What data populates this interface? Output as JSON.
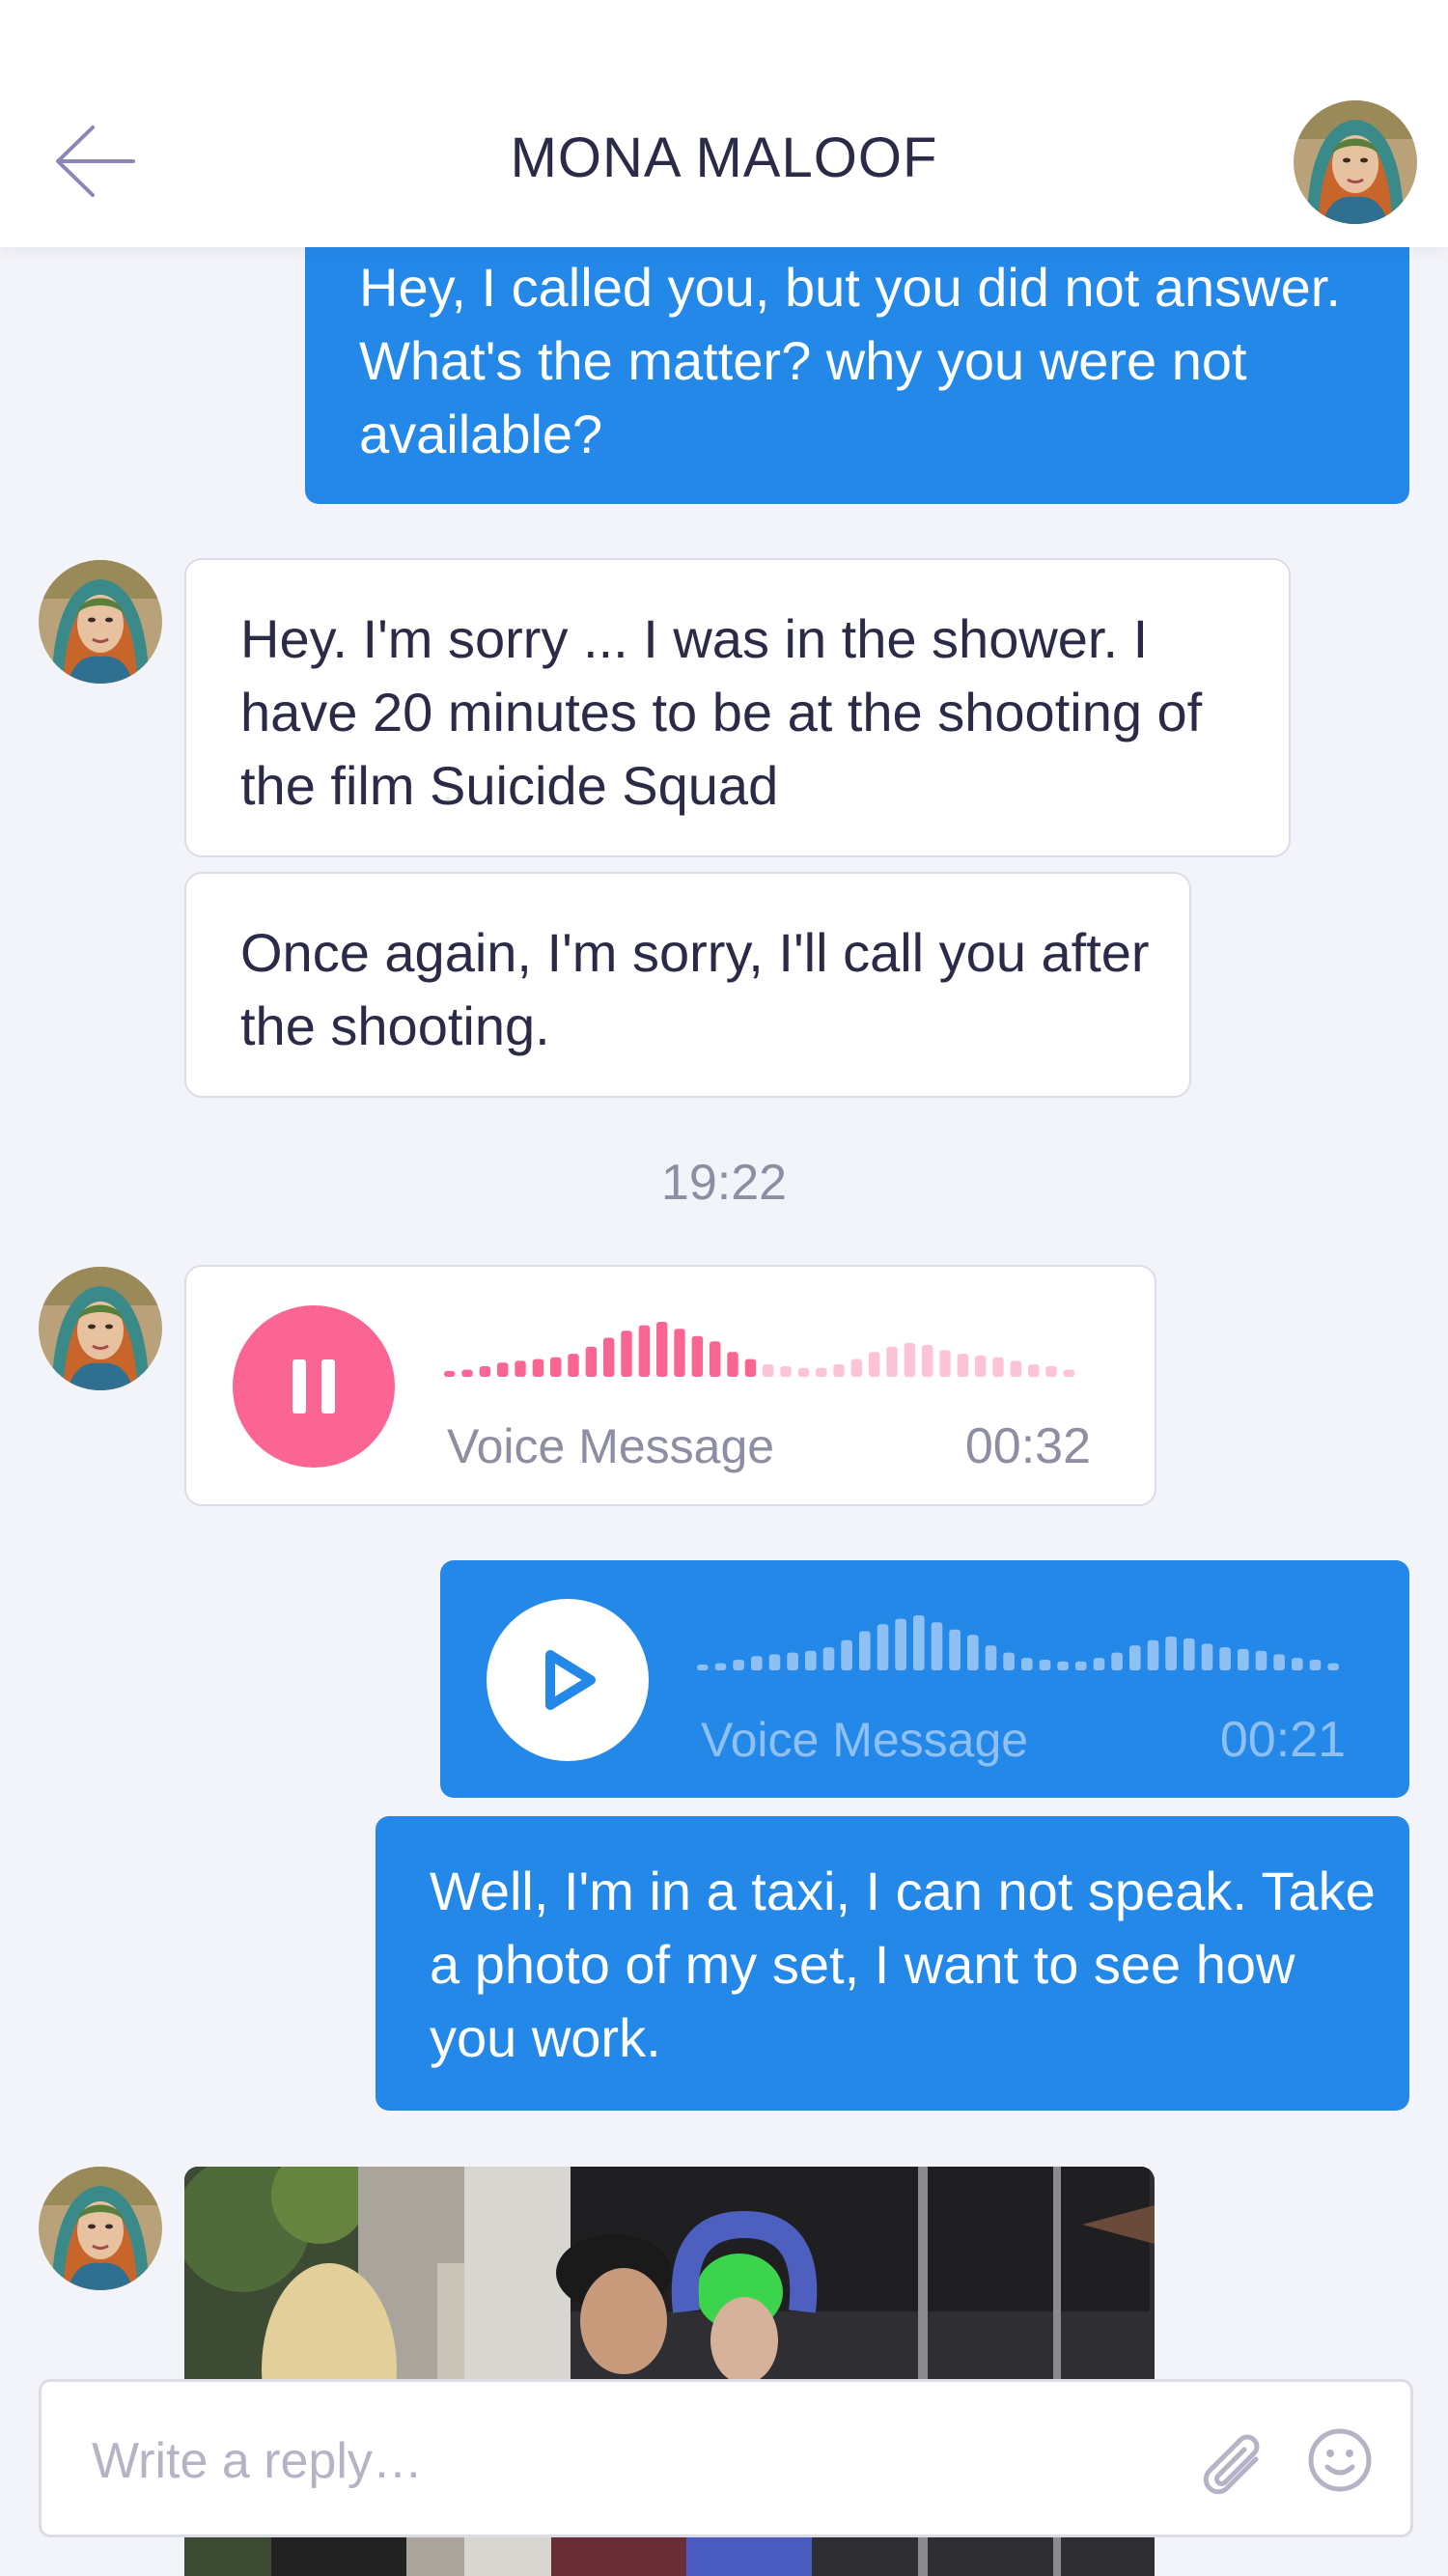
{
  "header": {
    "back_icon": "arrow-left-icon",
    "title": "MONA MALOOF"
  },
  "colors": {
    "accent": "#2488e8",
    "voice_pink": "#fb6593",
    "background": "#f3f4f9"
  },
  "messages": [
    {
      "side": "out",
      "type": "text",
      "text": "Hey, I called you, but you did not answer. What's the matter? why you were not available?"
    },
    {
      "side": "in",
      "type": "text",
      "text": "Hey. I'm sorry ... I was in the shower. I have 20 minutes to be at the shooting of the film Suicide Squad"
    },
    {
      "side": "in",
      "type": "text",
      "text": "Once again, I'm sorry, I'll call you after the shooting."
    },
    {
      "type": "timestamp",
      "text": "19:22"
    },
    {
      "side": "in",
      "type": "voice",
      "label": "Voice Message",
      "duration": "00:32",
      "state": "playing",
      "icon": "pause-icon"
    },
    {
      "side": "out",
      "type": "voice",
      "label": "Voice Message",
      "duration": "00:21",
      "state": "paused",
      "icon": "play-icon"
    },
    {
      "side": "out",
      "type": "text",
      "text": "Well, I'm in a taxi, I can not speak. Take a photo of my set, I want to see how you work."
    },
    {
      "side": "in",
      "type": "photo",
      "icon": "photo-attachment"
    }
  ],
  "composer": {
    "placeholder": "Write a reply…",
    "attach_icon": "paperclip-icon",
    "emoji_icon": "smiley-icon"
  }
}
